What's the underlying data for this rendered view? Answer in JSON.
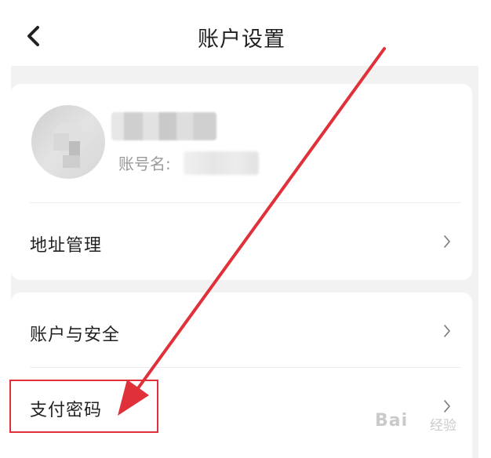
{
  "header": {
    "title": "账户设置",
    "back_icon": "chevron-left-icon"
  },
  "profile": {
    "account_label": "账号名:",
    "avatar": "avatar"
  },
  "menu": {
    "address": "地址管理",
    "account_security": "账户与安全",
    "payment_password": "支付密码",
    "chevron_icon": "chevron-right-icon"
  },
  "watermark": {
    "brand": "Bai",
    "sub": "经验"
  },
  "colors": {
    "highlight": "#e0313a",
    "background": "#f2f2f2"
  }
}
